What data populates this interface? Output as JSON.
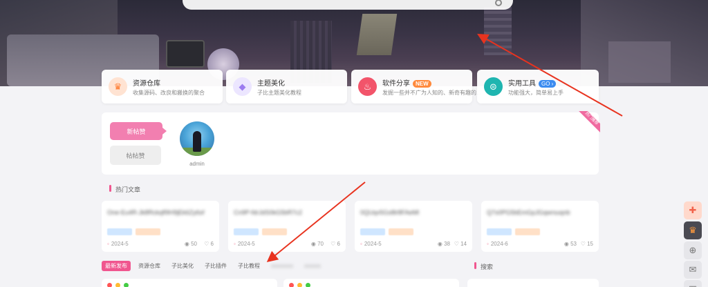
{
  "search": {
    "placeholder": ""
  },
  "categories": [
    {
      "title": "资源仓库",
      "desc": "收集源码、改良和搬换的聚合",
      "icon": "crown-icon",
      "color": "#ff8a3d"
    },
    {
      "title": "主题美化",
      "desc": "子比主题美化教程",
      "icon": "gem-icon",
      "color": "#9c7cf0"
    },
    {
      "title": "软件分享",
      "badge": "NEW",
      "desc": "发掘一些并不广为人知的、新奇有趣的...",
      "icon": "flame-icon",
      "color": "#f2546a"
    },
    {
      "title": "实用工具",
      "badge": "GO",
      "desc": "功能强大，简单易上手",
      "icon": "tool-icon",
      "color": "#1fb5b0"
    }
  ],
  "panel": {
    "tab_new": "新帖赞",
    "tab_old": "帖帖赞",
    "username": "admin",
    "ribbon": "热门推荐"
  },
  "hot_title": "热门文章",
  "articles": [
    {
      "title": "One-Eu4R-Jk8Rckqfl9H9jEk6Zy6sf",
      "date": "2024-5",
      "views": "50",
      "likes": "6"
    },
    {
      "title": "Cn9P-fdrJdS0kG5bR7c2",
      "date": "2024-5",
      "views": "70",
      "likes": "6"
    },
    {
      "title": "0QUqv5Gs8lr8FAeMl",
      "date": "2024-5",
      "views": "38",
      "likes": "14"
    },
    {
      "title": "Q7s0PG5bEmGpJGqwrsuqnb",
      "date": "2024-6",
      "views": "53",
      "likes": "15"
    }
  ],
  "bottom_tabs": [
    "最新发布",
    "资源仓库",
    "子比美化",
    "子比插件",
    "子比教程",
    "xxxxxxxx",
    "xxxxxx"
  ],
  "search_title": "搜索",
  "colors": {
    "accent": "#f0568f",
    "arrow": "#e8331f"
  }
}
